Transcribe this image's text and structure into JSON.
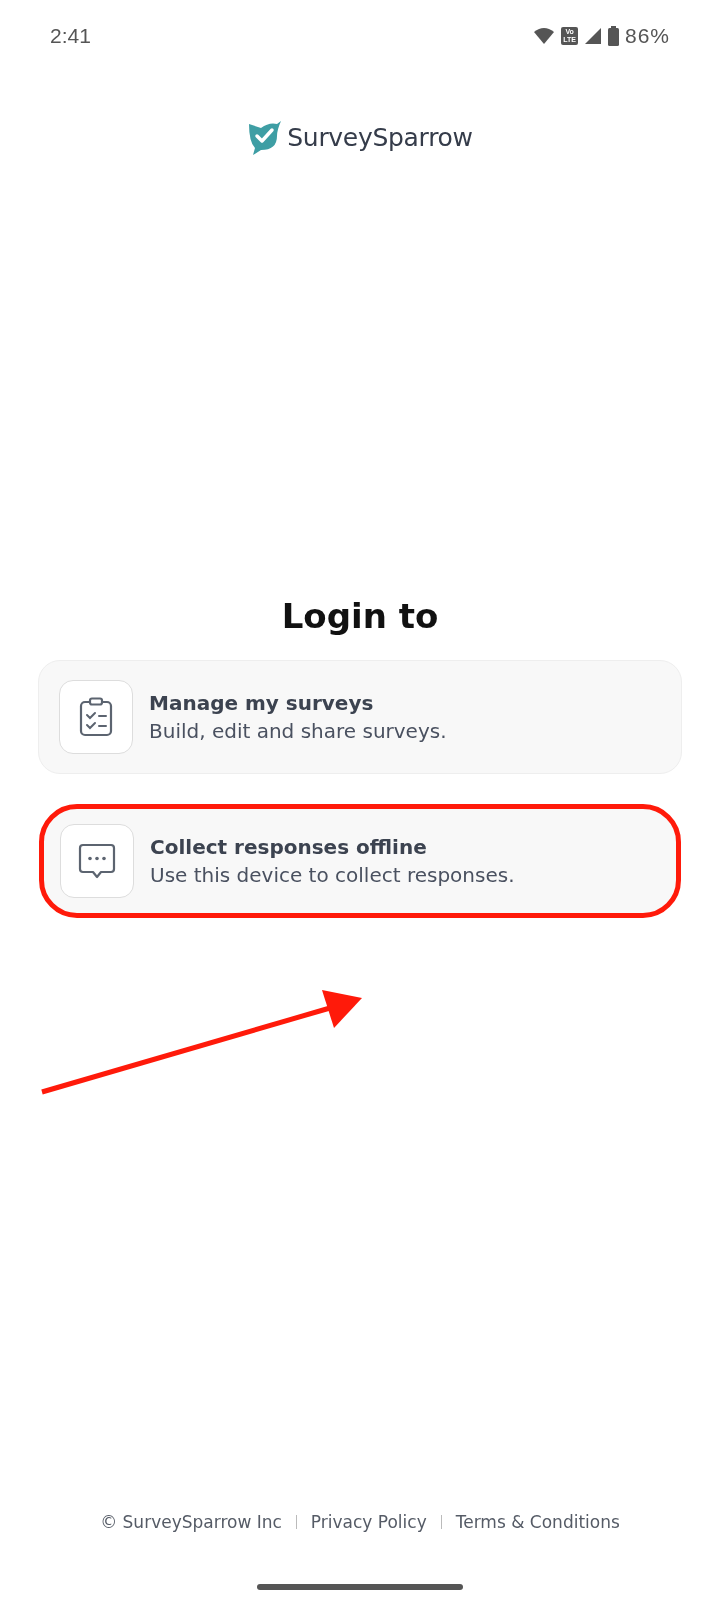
{
  "status_bar": {
    "time": "2:41",
    "network_label": "Vo LTE",
    "battery": "86%"
  },
  "logo": {
    "name": "SurveySparrow"
  },
  "title": "Login to",
  "options": [
    {
      "kind": "clipboard",
      "title": "Manage my surveys",
      "subtitle": "Build, edit and share surveys.",
      "highlighted": false
    },
    {
      "kind": "chat",
      "title": "Collect responses offline",
      "subtitle": "Use this device to collect responses.",
      "highlighted": true
    }
  ],
  "annotation": {
    "arrow": true
  },
  "footer": [
    "© SurveySparrow Inc",
    "Privacy Policy",
    "Terms & Conditions"
  ]
}
